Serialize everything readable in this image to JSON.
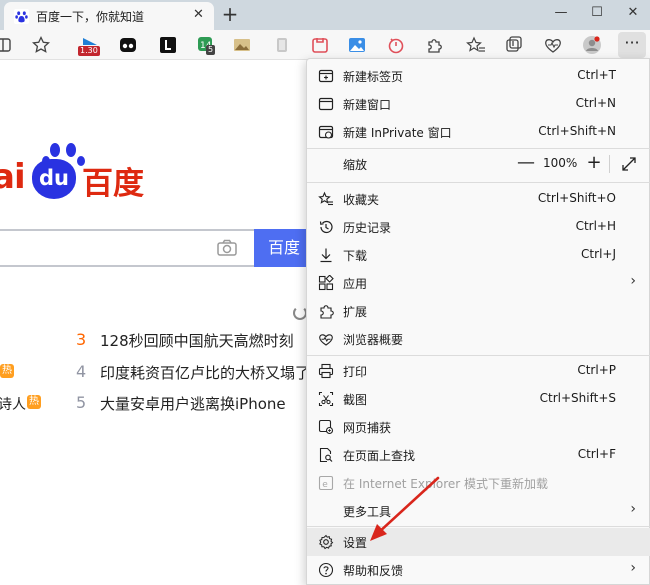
{
  "tab": {
    "title": "百度一下，你就知道",
    "close_glyph": "✕"
  },
  "new_tab_glyph": "+",
  "window_controls": {
    "minimize": "—",
    "maximize": "☐",
    "close": "✕"
  },
  "toolbar": {
    "badge_1": "1.30",
    "badge_2": "5",
    "more_glyph": "···"
  },
  "page": {
    "logo_partial": "ai",
    "logo_du": "du",
    "logo_cn": "百度",
    "search_button": "百度一",
    "hot_list": [
      {
        "num": "3",
        "text": "128秒回顾中国航天高燃时刻",
        "num_color": "#ff6600"
      },
      {
        "num": "4",
        "text": "印度耗资百亿卢比的大桥又塌了",
        "num_color": "#9195a3"
      },
      {
        "num": "5",
        "text": "大量安卓用户逃离换iPhone",
        "num_color": "#9195a3"
      }
    ],
    "left_fragments": [
      {
        "text": "",
        "tag": "热"
      },
      {
        "text": "诗人",
        "tag": "热"
      }
    ]
  },
  "menu": {
    "new_tab": {
      "label": "新建标签页",
      "shortcut": "Ctrl+T"
    },
    "new_window": {
      "label": "新建窗口",
      "shortcut": "Ctrl+N"
    },
    "new_inprivate": {
      "label": "新建 InPrivate 窗口",
      "shortcut": "Ctrl+Shift+N"
    },
    "zoom": {
      "label": "缩放",
      "minus": "—",
      "value": "100%",
      "plus": "+"
    },
    "favorites": {
      "label": "收藏夹",
      "shortcut": "Ctrl+Shift+O"
    },
    "history": {
      "label": "历史记录",
      "shortcut": "Ctrl+H"
    },
    "downloads": {
      "label": "下载",
      "shortcut": "Ctrl+J"
    },
    "apps": {
      "label": "应用",
      "arrow": "›"
    },
    "extensions": {
      "label": "扩展"
    },
    "browser_essentials": {
      "label": "浏览器概要"
    },
    "print": {
      "label": "打印",
      "shortcut": "Ctrl+P"
    },
    "screenshot": {
      "label": "截图",
      "shortcut": "Ctrl+Shift+S"
    },
    "web_capture": {
      "label": "网页捕获"
    },
    "find_on_page": {
      "label": "在页面上查找",
      "shortcut": "Ctrl+F"
    },
    "ie_mode": {
      "label": "在 Internet Explorer 模式下重新加载"
    },
    "more_tools": {
      "label": "更多工具",
      "arrow": "›"
    },
    "settings": {
      "label": "设置"
    },
    "help": {
      "label": "帮助和反馈",
      "arrow": "›"
    }
  },
  "colors": {
    "accent_arrow": "#d9261c",
    "baidu_red": "#de2910",
    "baidu_blue": "#2932e1",
    "search_button": "#4e6ef2"
  }
}
